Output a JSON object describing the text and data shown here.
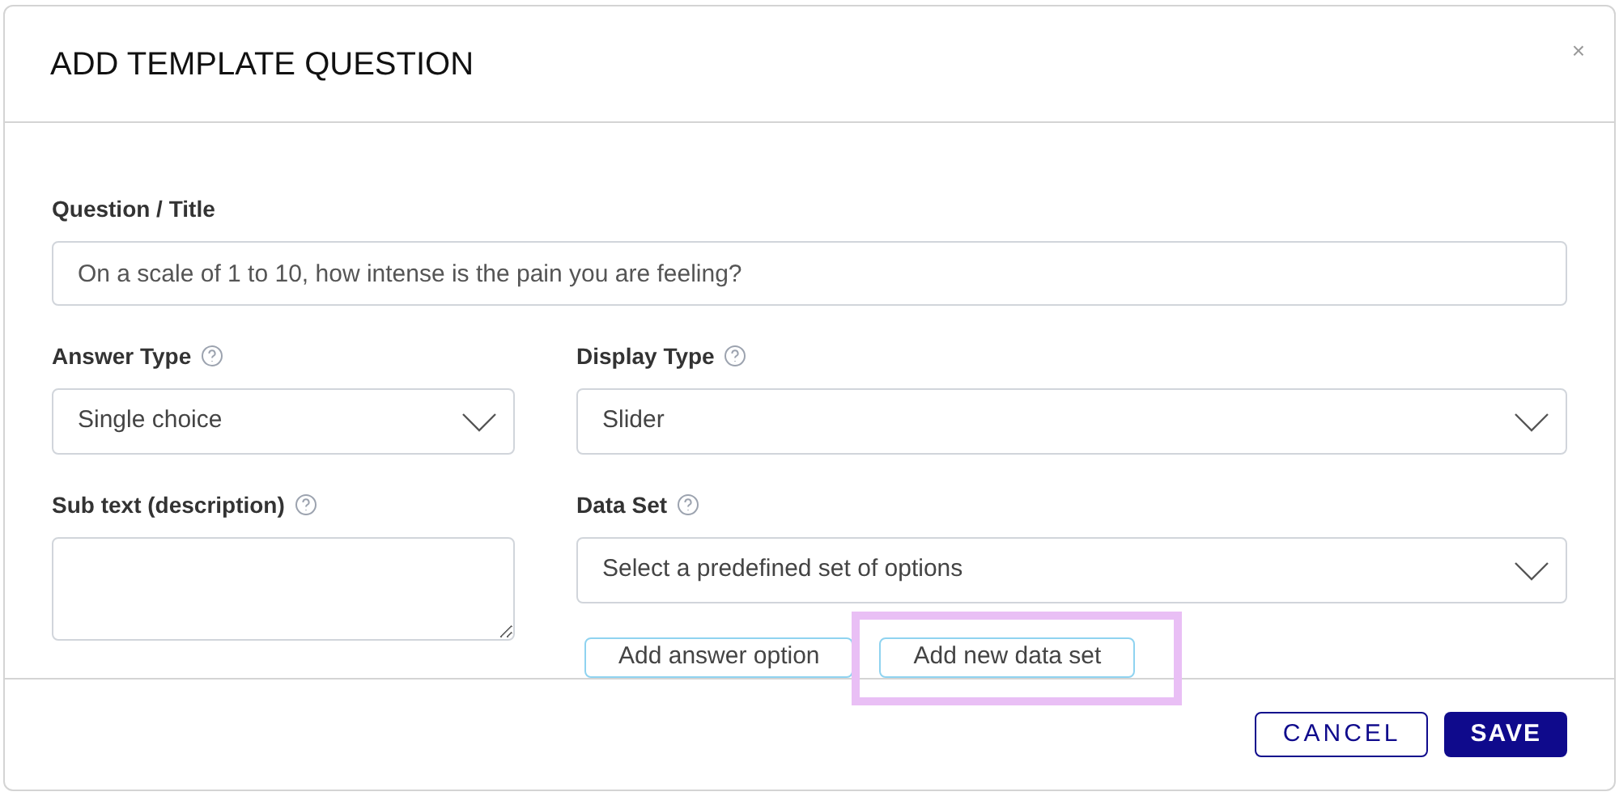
{
  "dialog": {
    "title": "ADD TEMPLATE QUESTION",
    "close": "×"
  },
  "question": {
    "label": "Question / Title",
    "value": "On a scale of 1 to 10, how intense is the pain you are feeling?"
  },
  "answer_type": {
    "label": "Answer Type",
    "help": true,
    "value": "Single choice"
  },
  "display_type": {
    "label": "Display Type",
    "help": true,
    "value": "Slider"
  },
  "sub_text": {
    "label": "Sub text (description)",
    "help": true
  },
  "data_set": {
    "label": "Data Set",
    "help": true,
    "placeholder": "Select a predefined set of options"
  },
  "option_buttons": [
    {
      "label": "Add answer option",
      "highlighted": false
    },
    {
      "label": "Add new data set",
      "highlighted": true
    }
  ],
  "footer_buttons": [
    {
      "label": "CANCEL",
      "kind": "outline"
    },
    {
      "label": "SAVE",
      "kind": "primary"
    }
  ]
}
